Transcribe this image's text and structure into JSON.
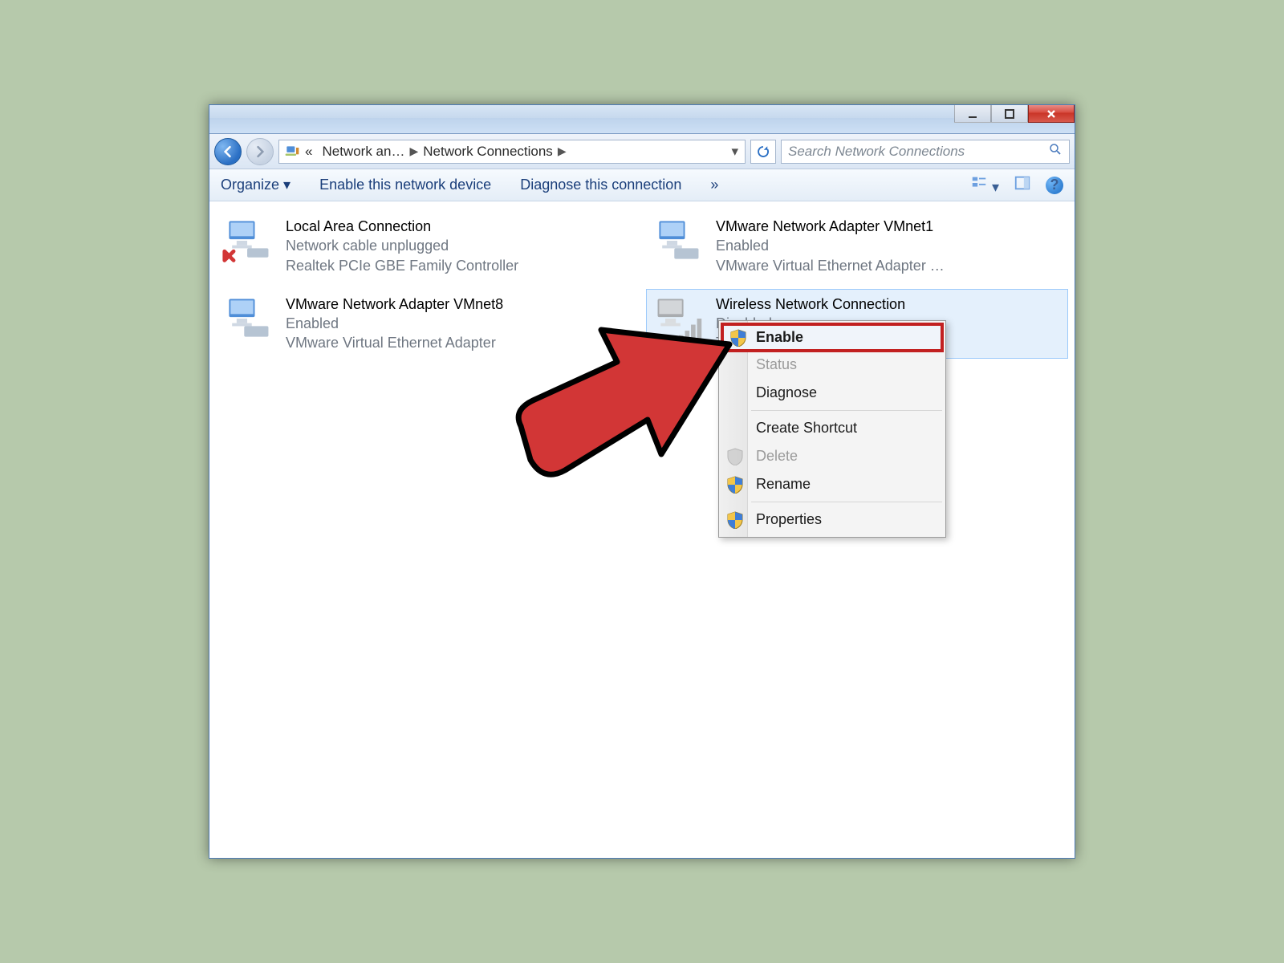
{
  "breadcrumb": {
    "seg1": "Network an…",
    "seg2": "Network Connections"
  },
  "search": {
    "placeholder": "Search Network Connections"
  },
  "commandbar": {
    "organize": "Organize ▾",
    "enable_device": "Enable this network device",
    "diagnose": "Diagnose this connection",
    "more": "»"
  },
  "connections": [
    {
      "name": "Local Area Connection",
      "status": "Network cable unplugged",
      "device": "Realtek PCIe GBE Family Controller",
      "unplugged": true
    },
    {
      "name": "VMware Network Adapter VMnet1",
      "status": "Enabled",
      "device": "VMware Virtual Ethernet Adapter …"
    },
    {
      "name": "VMware Network Adapter VMnet8",
      "status": "Enabled",
      "device": "VMware Virtual Ethernet Adapter"
    },
    {
      "name": "Wireless Network Connection",
      "status": "Disabled",
      "device": "TP-LINK 150…",
      "selected": true,
      "disabled": true
    }
  ],
  "context_menu": {
    "enable": "Enable",
    "status": "Status",
    "diagnose": "Diagnose",
    "create_shortcut": "Create Shortcut",
    "delete": "Delete",
    "rename": "Rename",
    "properties": "Properties"
  }
}
